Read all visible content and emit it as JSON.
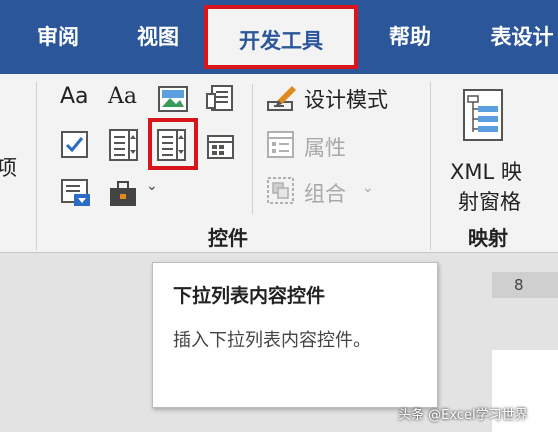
{
  "tabs": [
    {
      "label": "审阅"
    },
    {
      "label": "视图"
    },
    {
      "label": "开发工具"
    },
    {
      "label": "帮助"
    },
    {
      "label": "表设计"
    }
  ],
  "ribbon": {
    "left_fragment": "项",
    "controls_group": {
      "label": "控件",
      "aa_rich": "Aa",
      "aa_plain": "Aa",
      "design_mode": "设计模式",
      "properties": "属性",
      "group": "组合"
    },
    "mapping_group": {
      "label": "映射",
      "xml_line1": "XML 映",
      "xml_line2": "射窗格"
    }
  },
  "ruler": {
    "number": "8"
  },
  "tooltip": {
    "title": "下拉列表内容控件",
    "description": "插入下拉列表内容控件。"
  },
  "watermark": "头条 @Excel学习世界",
  "colors": {
    "accent": "#2b579a",
    "highlight": "#d9141b"
  }
}
